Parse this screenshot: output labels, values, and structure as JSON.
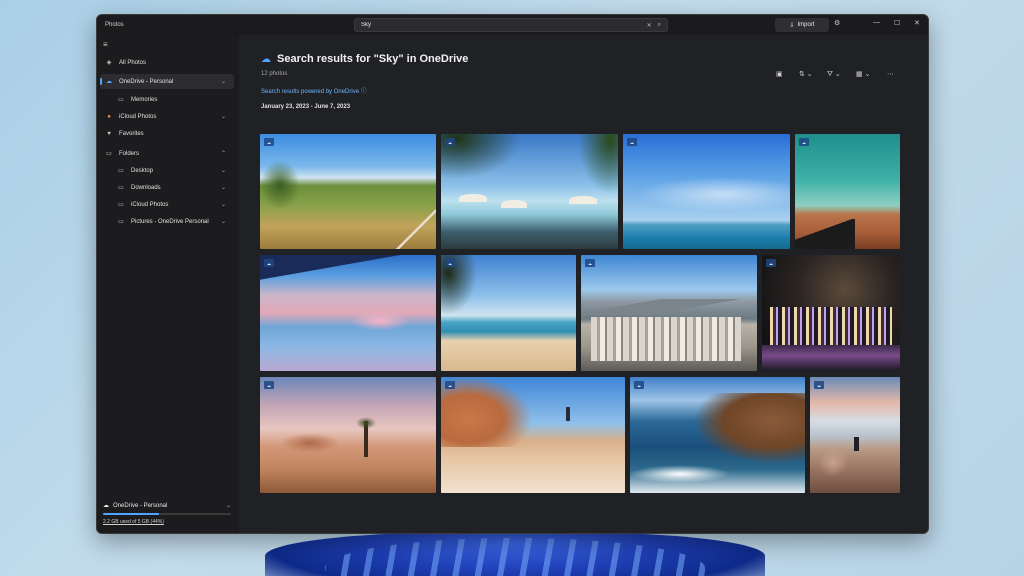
{
  "window": {
    "app_title": "Photos",
    "search_value": "Sky",
    "import_label": "Import"
  },
  "sidebar": {
    "items": [
      {
        "label": "All Photos",
        "icon": "photos-icon"
      },
      {
        "label": "OneDrive - Personal",
        "icon": "cloud-icon",
        "active": true,
        "expandable": true
      },
      {
        "label": "Memories",
        "icon": "folder-icon",
        "indent": true
      },
      {
        "label": "iCloud Photos",
        "icon": "icloud-icon",
        "expandable": true
      },
      {
        "label": "Favorites",
        "icon": "heart-icon"
      },
      {
        "label": "Folders",
        "icon": "folder-icon",
        "expandable": true
      },
      {
        "label": "Desktop",
        "icon": "folder-icon",
        "indent": true,
        "expandable": true
      },
      {
        "label": "Downloads",
        "icon": "folder-icon",
        "indent": true,
        "expandable": true
      },
      {
        "label": "iCloud Photos",
        "icon": "folder-icon",
        "indent": true,
        "expandable": true
      },
      {
        "label": "Pictures - OneDrive Personal",
        "icon": "folder-icon",
        "indent": true,
        "expandable": true
      }
    ],
    "storage": {
      "title": "OneDrive - Personal",
      "usage": "2.2 GB used of 5 GB (44%)",
      "fraction_used": 0.44
    }
  },
  "main": {
    "title": "Search results for \"Sky\" in OneDrive",
    "count": "12 photos",
    "powered_by": "Search results powered by OneDrive",
    "date_range": "January 23, 2023 - June 7, 2023"
  },
  "colors": {
    "accent": "#4ea4ff",
    "window_bg": "#202124",
    "sidebar_bg": "#1c1c1e"
  },
  "photos": [
    {
      "name": "photo-hillside-meadow"
    },
    {
      "name": "photo-beach-umbrellas-palms"
    },
    {
      "name": "photo-blue-sea-horizon"
    },
    {
      "name": "photo-cliff-turquoise-sky"
    },
    {
      "name": "photo-airplane-wing-clouds"
    },
    {
      "name": "photo-sandy-beach-shore"
    },
    {
      "name": "photo-city-mountains"
    },
    {
      "name": "photo-night-skyline"
    },
    {
      "name": "photo-desert-joshua-tree"
    },
    {
      "name": "photo-rock-hiker"
    },
    {
      "name": "photo-sea-cliffs-waves"
    },
    {
      "name": "photo-rocky-coast-people"
    }
  ]
}
